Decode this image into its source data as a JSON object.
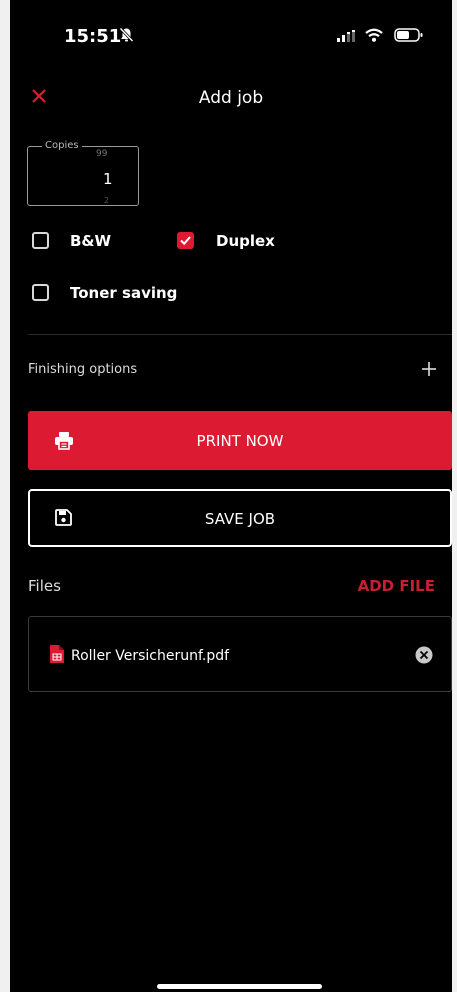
{
  "status_bar": {
    "time": "15:51"
  },
  "header": {
    "title": "Add job"
  },
  "copies": {
    "label": "Copies",
    "value": "1",
    "above": "99",
    "below": "2"
  },
  "options": {
    "bw": {
      "label": "B&W",
      "checked": false
    },
    "duplex": {
      "label": "Duplex",
      "checked": true
    },
    "toner": {
      "label": "Toner saving",
      "checked": false
    }
  },
  "finishing": {
    "label": "Finishing options"
  },
  "actions": {
    "print_label": "PRINT NOW",
    "save_label": "SAVE JOB"
  },
  "files": {
    "label": "Files",
    "add_label": "ADD FILE",
    "items": [
      {
        "name": "Roller Versicherunf.pdf"
      }
    ]
  },
  "colors": {
    "accent": "#dc1b32",
    "background": "#000000",
    "add_file": "#c51f31"
  },
  "icons": [
    "bell-slash-icon",
    "signal-icon",
    "wifi-icon",
    "battery-icon",
    "close-icon",
    "checkmark-icon",
    "plus-icon",
    "printer-icon",
    "floppy-disk-icon",
    "pdf-file-icon",
    "remove-icon"
  ]
}
